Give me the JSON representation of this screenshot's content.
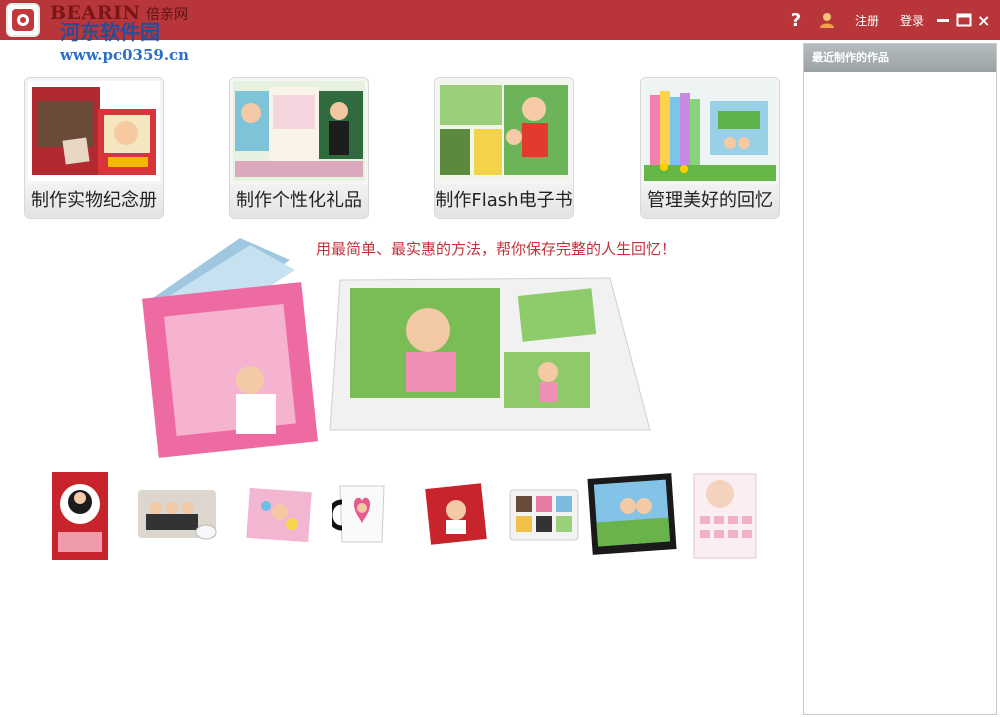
{
  "titlebar": {
    "brand": "BEARIN",
    "brand_cn": "倍亲网",
    "watermark_top": "河东软件园",
    "watermark_url": "www.pc0359.cn",
    "help": "?",
    "register": "注册",
    "login": "登录"
  },
  "tiles": [
    {
      "label": "制作实物纪念册"
    },
    {
      "label": "制作个性化礼品"
    },
    {
      "label": "制作Flash电子书"
    },
    {
      "label": "管理美好的回忆"
    }
  ],
  "banner": {
    "slogan": "用最简单、最实惠的方法，帮你保存完整的人生回忆！"
  },
  "sidebar": {
    "title": "最近制作的作品"
  },
  "colors": {
    "titlebar": "#b8363a",
    "accent_red": "#c4303a",
    "sidebar_header": "#a2a9ad"
  }
}
